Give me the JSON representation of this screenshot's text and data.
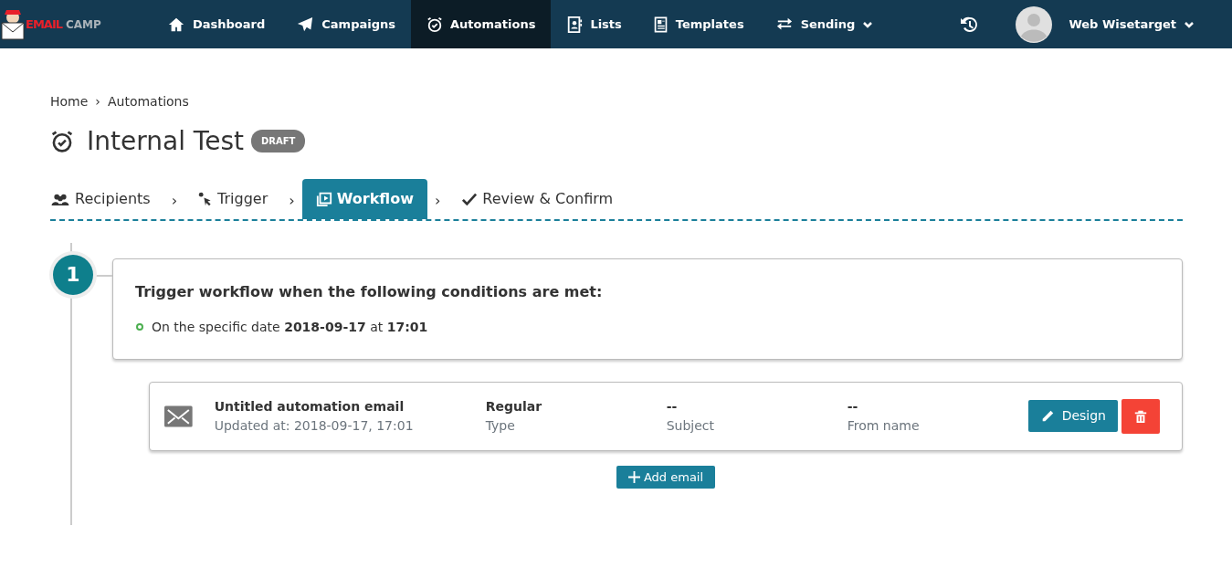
{
  "logo": {
    "parts": [
      "EMAIL",
      "CAMP"
    ]
  },
  "nav": [
    {
      "label": "Dashboard",
      "selected": false,
      "dropdown": false
    },
    {
      "label": "Campaigns",
      "selected": false,
      "dropdown": false
    },
    {
      "label": "Automations",
      "selected": true,
      "dropdown": false
    },
    {
      "label": "Lists",
      "selected": false,
      "dropdown": false
    },
    {
      "label": "Templates",
      "selected": false,
      "dropdown": false
    },
    {
      "label": "Sending",
      "selected": false,
      "dropdown": true
    }
  ],
  "user": {
    "name": "Web Wisetarget"
  },
  "breadcrumb": {
    "items": [
      "Home",
      "Automations"
    ],
    "separator": "›"
  },
  "page": {
    "title": "Internal Test",
    "badge": "DRAFT"
  },
  "steps": [
    {
      "label": "Recipients",
      "selected": false
    },
    {
      "label": "Trigger",
      "selected": false
    },
    {
      "label": "Workflow",
      "selected": true
    },
    {
      "label": "Review & Confirm",
      "selected": false
    }
  ],
  "step_separator": "›",
  "workflow": {
    "number": "1",
    "heading": "Trigger workflow when the following conditions are met:",
    "condition": "On the specific date **2018-09-17** at **17:01**",
    "email": {
      "title": "Untitled automation email",
      "updated": "Updated at: 2018-09-17, 17:01",
      "fields": [
        {
          "value": "Regular",
          "label": "Type"
        },
        {
          "value": "--",
          "label": "Subject"
        },
        {
          "value": "--",
          "label": "From name"
        }
      ],
      "design_button": "Design"
    },
    "add_button": "Add email"
  }
}
